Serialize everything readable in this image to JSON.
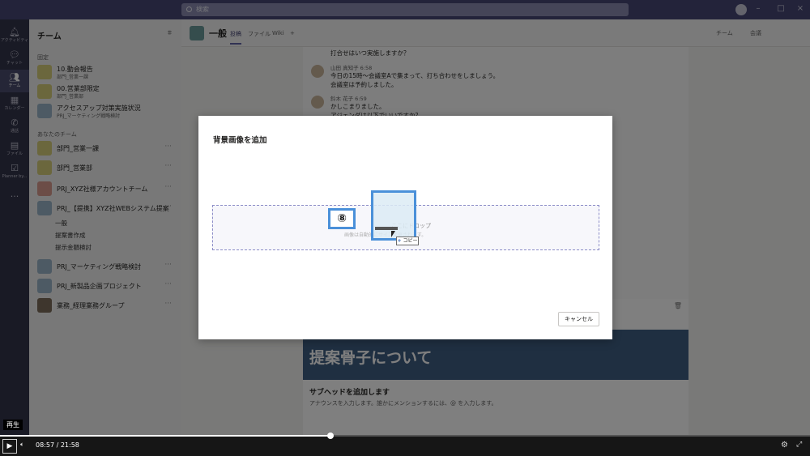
{
  "topbar": {
    "search_placeholder": "検索"
  },
  "rail": {
    "items": [
      {
        "icon": "bell-icon",
        "label": "アクティビティ"
      },
      {
        "icon": "chat-icon",
        "label": "チャット"
      },
      {
        "icon": "teams-icon",
        "label": "チーム"
      },
      {
        "icon": "calendar-icon",
        "label": "カレンダー"
      },
      {
        "icon": "phone-icon",
        "label": "通話"
      },
      {
        "icon": "file-icon",
        "label": "ファイル"
      },
      {
        "icon": "planner-icon",
        "label": "Planner by..."
      },
      {
        "icon": "more-icon",
        "label": "..."
      }
    ]
  },
  "teams": {
    "title": "チーム",
    "pinned_label": "固定",
    "your_teams_label": "あなたのチーム",
    "pinned": [
      {
        "name": "10.動会報告",
        "sub": "部門_営業一課"
      },
      {
        "name": "00.営業部限定",
        "sub": "部門_営業部"
      },
      {
        "name": "アクセスアップ対策実施状況",
        "sub": "PRJ_マーケティング戦略検討"
      }
    ],
    "list": [
      {
        "name": "部門_営業一課"
      },
      {
        "name": "部門_営業部"
      },
      {
        "name": "PRJ_XYZ社様アカウントチーム"
      },
      {
        "name": "PRJ_【提携】XYZ社WEBシステム提案"
      },
      {
        "name": "PRJ_マーケティング戦略検討"
      },
      {
        "name": "PRJ_新製品企画プロジェクト"
      },
      {
        "name": "業務_経理業務グループ"
      }
    ],
    "channels": [
      "一般",
      "提案書作成",
      "提示金額検討"
    ]
  },
  "main": {
    "channel_title": "一般",
    "tabs": [
      "投稿",
      "ファイル",
      "Wiki",
      "+"
    ],
    "header_right": [
      "チーム",
      "会議"
    ],
    "messages": [
      {
        "name": "",
        "lines": [
          "打合せはいつ実施しますか？"
        ]
      },
      {
        "name": "山田 真知子  6:58",
        "lines": [
          "今日の15時～会議室Aで集まって、打ち合わせをしましょう。",
          "会議室は予約しました。"
        ]
      },
      {
        "name": "鈴木 花子  6:59",
        "lines": [
          "かしこまりました。",
          "アジェンダは以下でいいですか？"
        ]
      }
    ],
    "card_banner": "提案骨子について",
    "card_subhead": "サブヘッドを追加します",
    "card_announce": "アナウンスを入力します。誰かにメンションするには、@ を入力します。"
  },
  "dialog": {
    "title": "背景画像を追加",
    "drop_text": "ここにドロップ",
    "drop_hint": "画像は自動的にサイズ変更されます。",
    "cancel_label": "キャンセル",
    "copy_badge": "コピー",
    "step_marker": "⑧"
  },
  "video": {
    "current_time": "08:57",
    "total_time": "21:58",
    "progress": 0.408,
    "tooltip": "再生"
  }
}
